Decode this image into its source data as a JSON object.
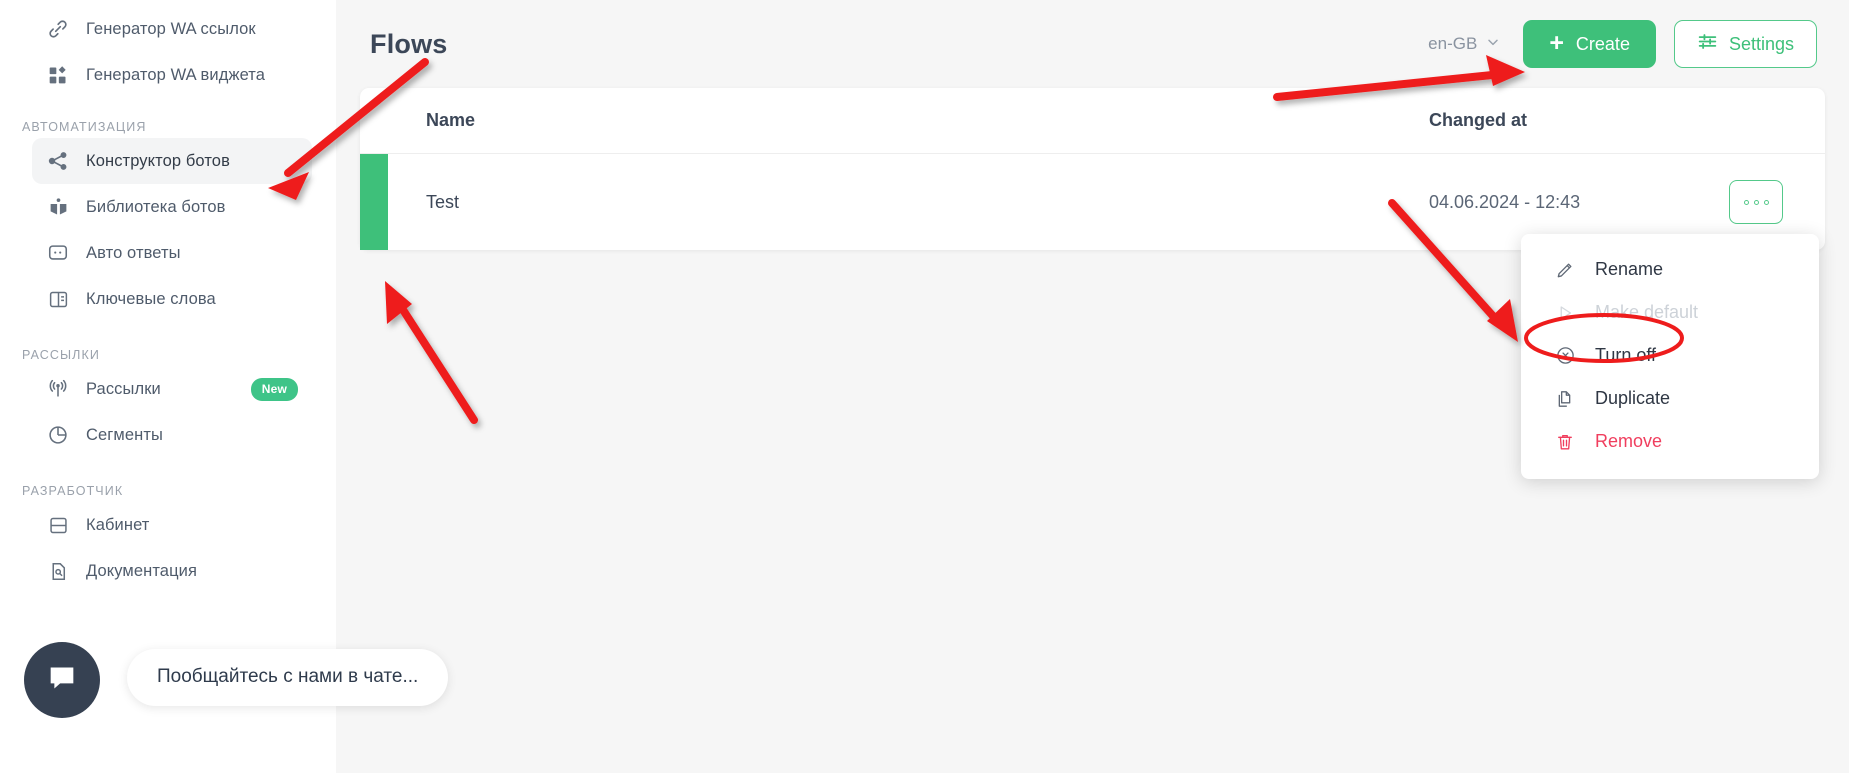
{
  "sidebar": {
    "items_top": [
      {
        "label": "Генератор WA ссылок",
        "icon": "link-icon",
        "active": false
      },
      {
        "label": "Генератор WA виджета",
        "icon": "widget-grid-icon",
        "active": false
      }
    ],
    "sections": [
      {
        "title": "АВТОМАТИЗАЦИЯ",
        "items": [
          {
            "label": "Конструктор ботов",
            "icon": "share-nodes-icon",
            "active": true
          },
          {
            "label": "Библиотека ботов",
            "icon": "book-icon",
            "active": false
          },
          {
            "label": "Авто ответы",
            "icon": "chat-dots-icon",
            "active": false
          },
          {
            "label": "Ключевые слова",
            "icon": "columns-icon",
            "active": false
          }
        ]
      },
      {
        "title": "РАССЫЛКИ",
        "items": [
          {
            "label": "Рассылки",
            "icon": "broadcast-icon",
            "active": false,
            "badge": "New"
          },
          {
            "label": "Сегменты",
            "icon": "pie-chart-icon",
            "active": false
          }
        ]
      },
      {
        "title": "РАЗРАБОТЧИК",
        "items": [
          {
            "label": "Кабинет",
            "icon": "cabinet-icon",
            "active": false
          },
          {
            "label": "Документация",
            "icon": "doc-search-icon",
            "active": false
          }
        ]
      }
    ]
  },
  "header": {
    "title": "Flows",
    "language": "en-GB",
    "create_label": "Create",
    "create_plus": "+",
    "settings_label": "Settings"
  },
  "table": {
    "columns": {
      "name": "Name",
      "changed_at": "Changed at"
    },
    "rows": [
      {
        "name": "Test",
        "changed_at": "04.06.2024 - 12:43",
        "status_color": "#3ec07a"
      }
    ]
  },
  "context_menu": {
    "items": [
      {
        "label": "Rename",
        "icon": "pencil-icon",
        "state": "enabled"
      },
      {
        "label": "Make default",
        "icon": "play-triangle-icon",
        "state": "disabled"
      },
      {
        "label": "Turn off",
        "icon": "circle-x-icon",
        "state": "enabled"
      },
      {
        "label": "Duplicate",
        "icon": "copy-icon",
        "state": "enabled"
      },
      {
        "label": "Remove",
        "icon": "trash-icon",
        "state": "danger"
      }
    ]
  },
  "chat_widget": {
    "message": "Пообщайтесь с нами в чате...",
    "icon": "chat-bubble-icon"
  },
  "colors": {
    "accent_green": "#3ec07a",
    "badge_green": "#3ec488",
    "danger_red": "#f03e5e",
    "annotation_red": "#ee1c1c",
    "text_dark": "#3c4758",
    "background": "#f6f6f6"
  }
}
